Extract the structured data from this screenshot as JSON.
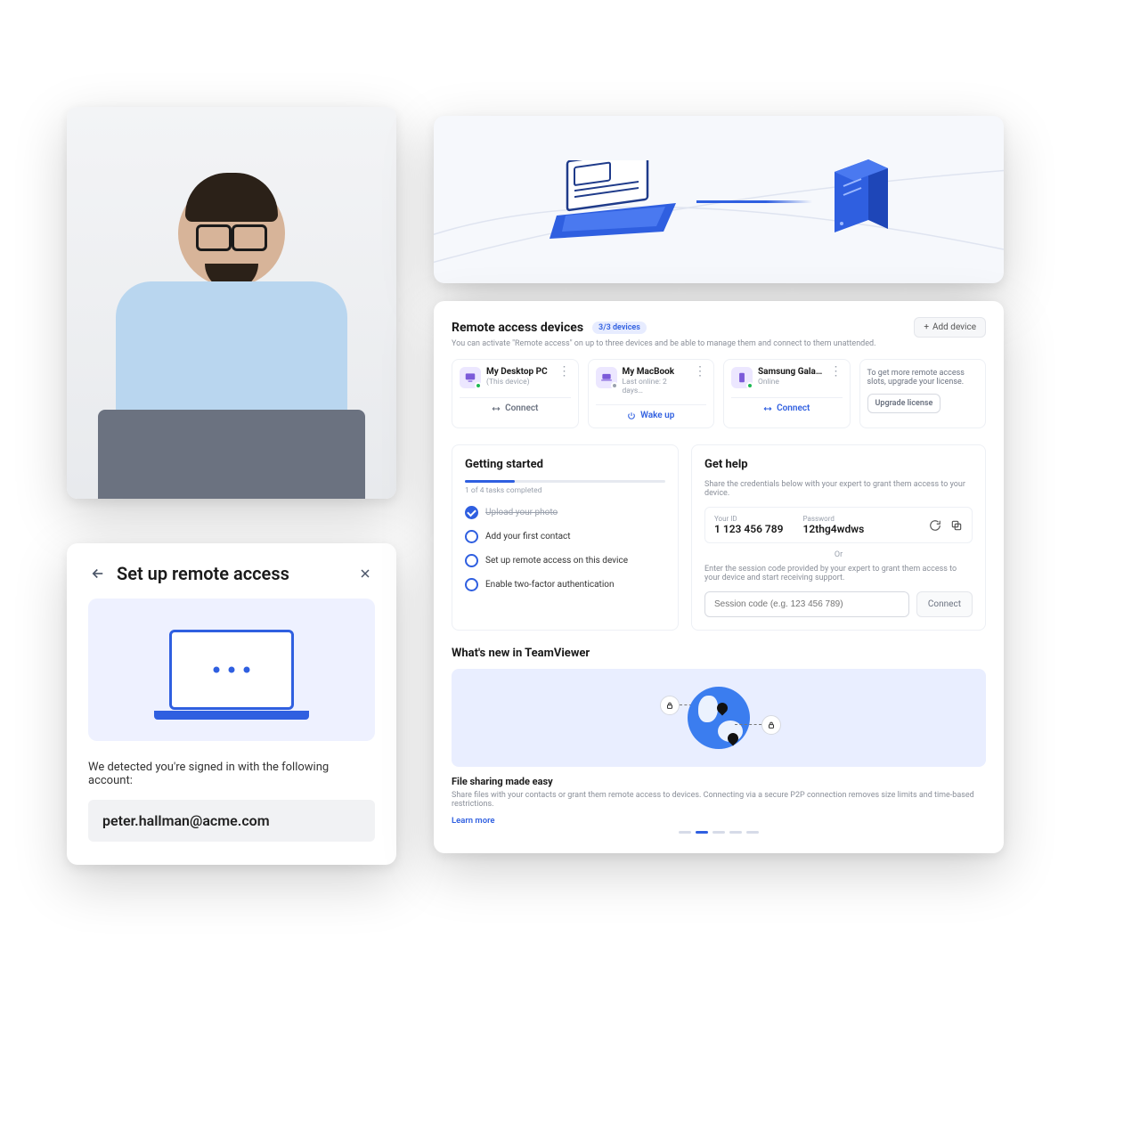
{
  "setup": {
    "title": "Set up remote access",
    "detected_text": "We detected you're signed in with the following account:",
    "email": "peter.hallman@acme.com"
  },
  "dashboard": {
    "devices_section": {
      "title": "Remote access devices",
      "badge": "3/3 devices",
      "subtitle": "You can activate \"Remote access\" on up to three devices and be able to manage them and connect to them unattended.",
      "add_label": "Add device"
    },
    "devices": [
      {
        "name": "My Desktop PC",
        "status": "(This device)",
        "action": "Connect",
        "type": "pc",
        "online": true,
        "action_style": "gray"
      },
      {
        "name": "My MacBook",
        "status": "Last online: 2 days…",
        "action": "Wake up",
        "type": "mac",
        "online": false,
        "action_style": "blue"
      },
      {
        "name": "Samsung Galaxy…",
        "status": "Online",
        "action": "Connect",
        "type": "mob",
        "online": true,
        "action_style": "blue"
      }
    ],
    "upgrade": {
      "text": "To get more remote access slots, upgrade your license.",
      "button": "Upgrade license"
    },
    "getting_started": {
      "title": "Getting started",
      "progress_text": "1 of 4 tasks completed",
      "tasks": [
        {
          "label": "Upload your photo",
          "done": true
        },
        {
          "label": "Add your first contact",
          "done": false
        },
        {
          "label": "Set up remote access on this device",
          "done": false
        },
        {
          "label": "Enable two-factor authentication",
          "done": false
        }
      ]
    },
    "get_help": {
      "title": "Get help",
      "share_text": "Share the credentials below with your expert to grant them access to your device.",
      "id_label": "Your ID",
      "id_value": "1 123 456 789",
      "pw_label": "Password",
      "pw_value": "12thg4wdws",
      "or": "Or",
      "enter_text": "Enter the session code provided by your expert to grant them access to your device and start receiving support.",
      "placeholder": "Session code (e.g. 123 456 789)",
      "connect": "Connect"
    },
    "whats_new": {
      "title": "What's new in TeamViewer",
      "item_title": "File sharing made easy",
      "item_body": "Share files with your contacts or grant them remote access to devices. Connecting via a secure P2P connection removes size limits and time-based restrictions.",
      "learn_more": "Learn more"
    }
  }
}
